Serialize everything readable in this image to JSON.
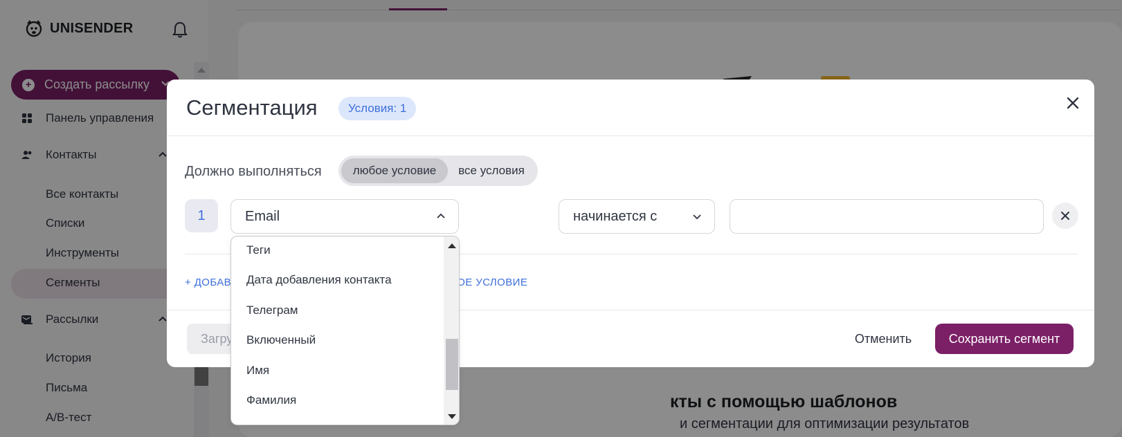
{
  "app": {
    "logo_text": "UNISENDER",
    "create_button": "Создать рассылку",
    "nav": {
      "dashboard": "Панель управления",
      "contacts": "Контакты",
      "contacts_sub": [
        "Все контакты",
        "Списки",
        "Инструменты",
        "Сегменты"
      ],
      "mailings": "Рассылки",
      "mailings_sub": [
        "История",
        "Письма",
        "A/B-тест"
      ]
    },
    "hero": {
      "title": "кты с помощью шаблонов",
      "subtitle": "и сегментации для оптимизации результатов"
    }
  },
  "modal": {
    "title": "Сегментация",
    "badge": "Условия: 1",
    "must_label": "Должно выполняться",
    "toggle": {
      "any": "любое условие",
      "all": "все условия",
      "selected": "any"
    },
    "condition": {
      "index": "1",
      "field": "Email",
      "operator": "начинается с",
      "value": ""
    },
    "add_condition": "+ ДОБАВ",
    "add_nested": "НОЕ УСЛОВИЕ",
    "load_button": "Загру",
    "cancel_button": "Отменить",
    "save_button": "Сохранить сегмент"
  },
  "dropdown": {
    "options": [
      "Теги",
      "Дата добавления контакта",
      "Телеграм",
      "Включенный",
      "Имя",
      "Фамилия"
    ]
  },
  "colors": {
    "brand": "#7b1f67",
    "link": "#3d6fd9",
    "badge_bg": "#dde7fb"
  }
}
